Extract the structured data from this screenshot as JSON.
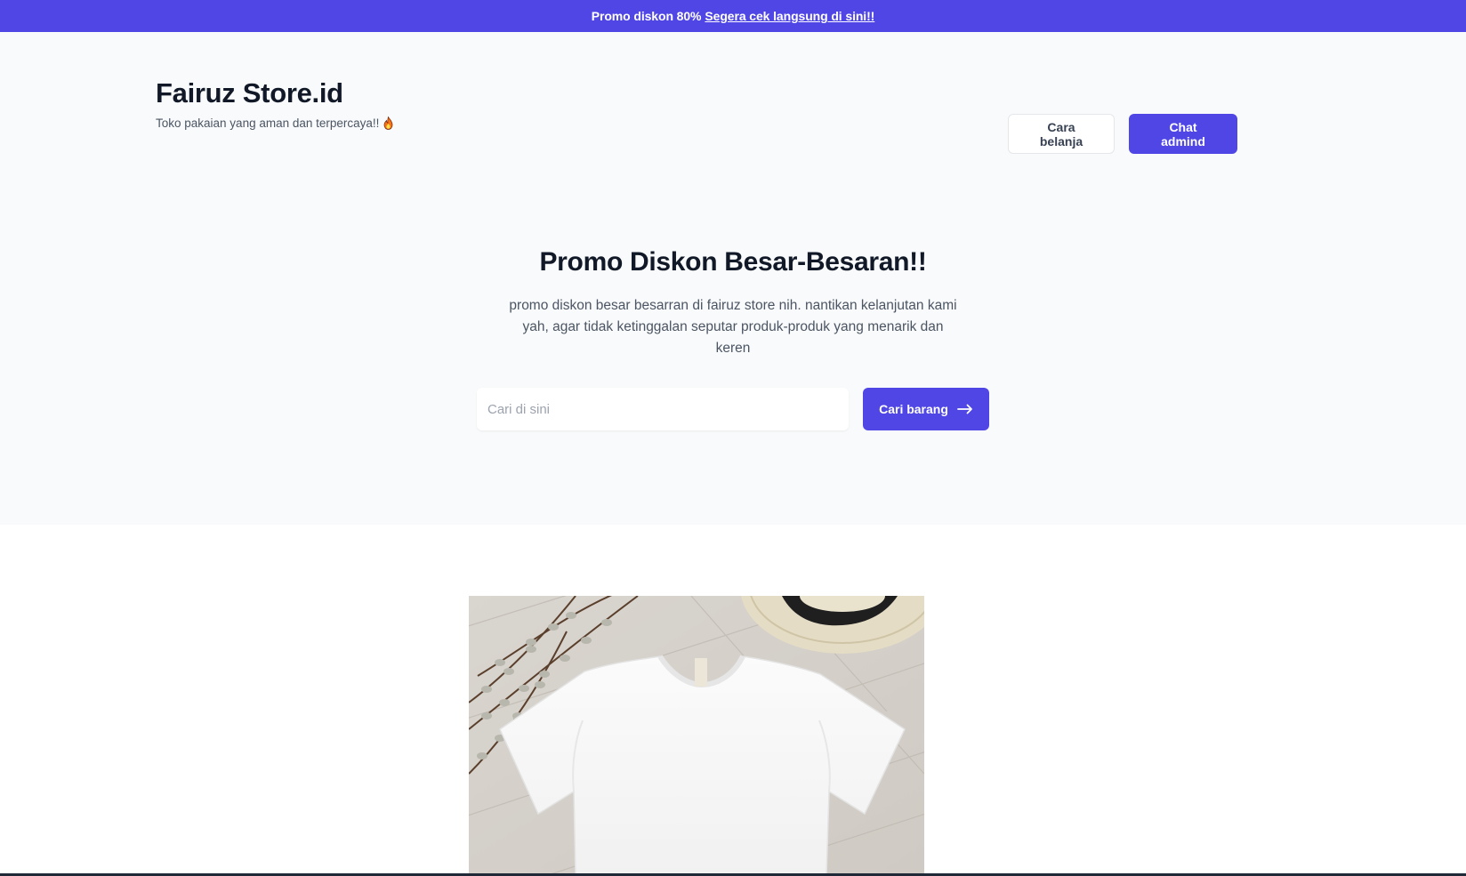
{
  "promo_bar": {
    "text": "Promo diskon 80%",
    "link_text": "Segera cek langsung di sini!!"
  },
  "header": {
    "title": "Fairuz Store.id",
    "tagline": "Toko pakaian yang aman dan terpercaya!!",
    "tagline_icon": "fire-icon",
    "buttons": {
      "how_to_shop": "Cara belanja",
      "chat_admin": "Chat admind"
    }
  },
  "hero": {
    "title": "Promo Diskon Besar-Besaran!!",
    "description": "promo diskon besar besarran di fairuz store nih. nantikan kelanjutan kami yah, agar tidak ketinggalan seputar produk-produk yang menarik dan keren",
    "search": {
      "placeholder": "Cari di sini",
      "value": "",
      "button_label": "Cari barang",
      "button_icon": "arrow-right-icon"
    }
  },
  "colors": {
    "primary": "#4f46e5",
    "hero_bg": "#f9fafb",
    "text_dark": "#111827",
    "text_muted": "#4b5563"
  }
}
